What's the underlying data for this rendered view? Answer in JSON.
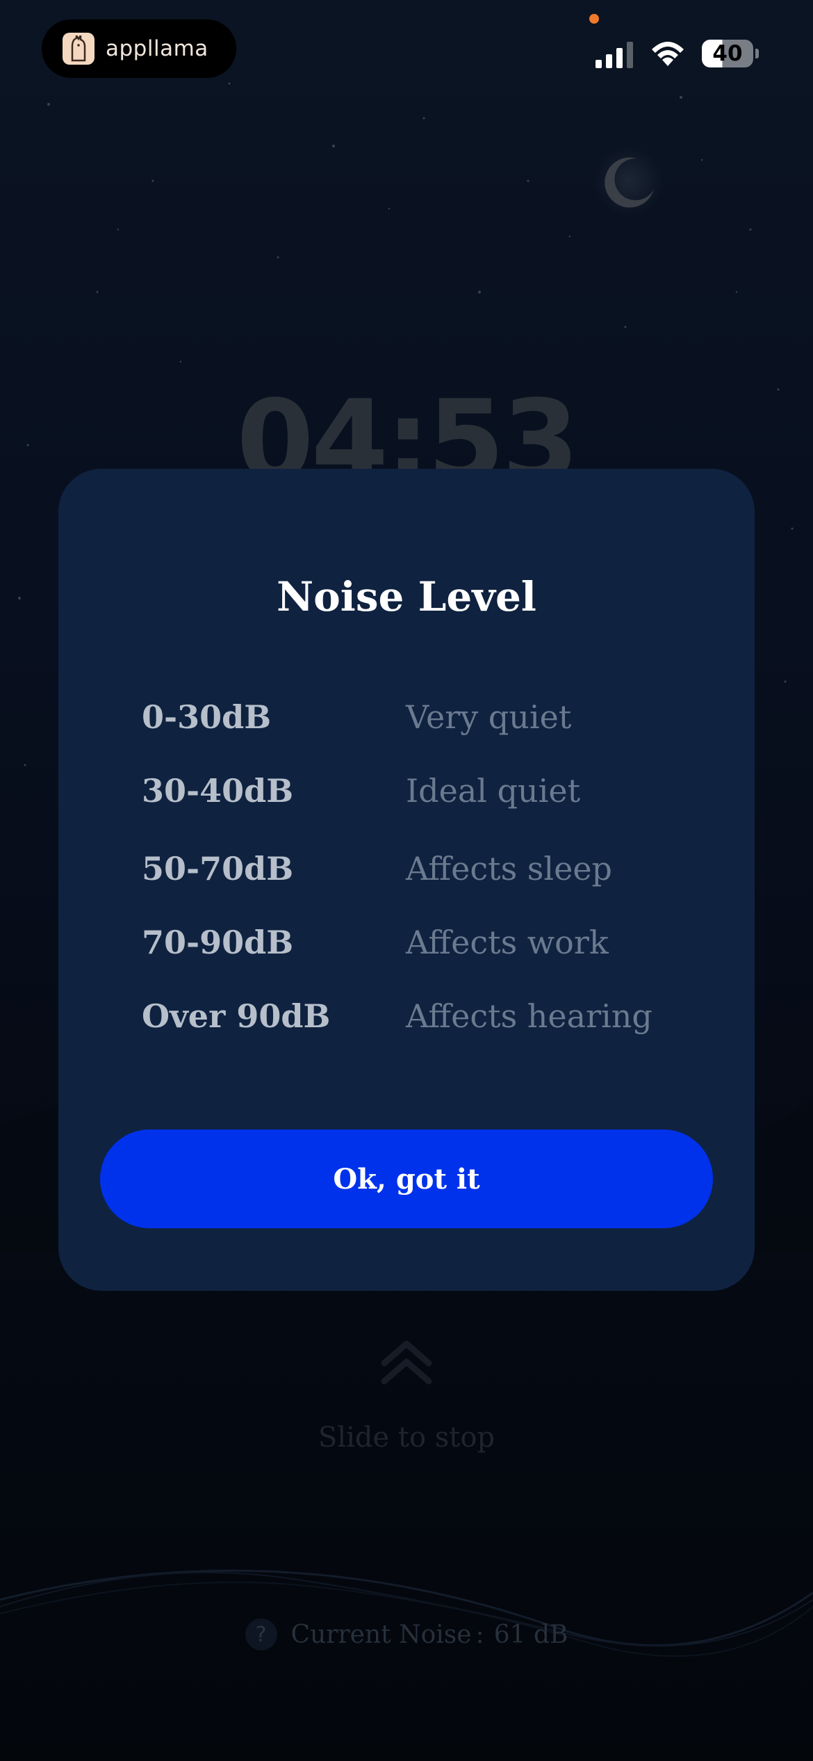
{
  "status_bar": {
    "brand_name": "appllama",
    "battery_level": "40"
  },
  "background": {
    "timer": "04:53",
    "slide_label": "Slide to stop",
    "current_noise_label": "Current Noise",
    "current_noise_separator": ":",
    "current_noise_value": "61 dB",
    "help_glyph": "?"
  },
  "modal": {
    "title": "Noise Level",
    "levels": [
      {
        "range": "0-30dB",
        "description": "Very quiet"
      },
      {
        "range": "30-40dB",
        "description": "Ideal quiet"
      },
      {
        "range": "50-70dB",
        "description": "Affects sleep"
      },
      {
        "range": "70-90dB",
        "description": "Affects work"
      },
      {
        "range": "Over 90dB",
        "description": "Affects hearing"
      }
    ],
    "confirm_label": "Ok, got it"
  },
  "colors": {
    "accent": "#0032ec",
    "modal_bg": "#0f2240",
    "status_dot": "#f07a2b"
  },
  "icons": [
    "llama-logo-icon",
    "signal-icon",
    "wifi-icon",
    "battery-icon",
    "moon-icon",
    "chevron-up-icon",
    "help-icon"
  ]
}
